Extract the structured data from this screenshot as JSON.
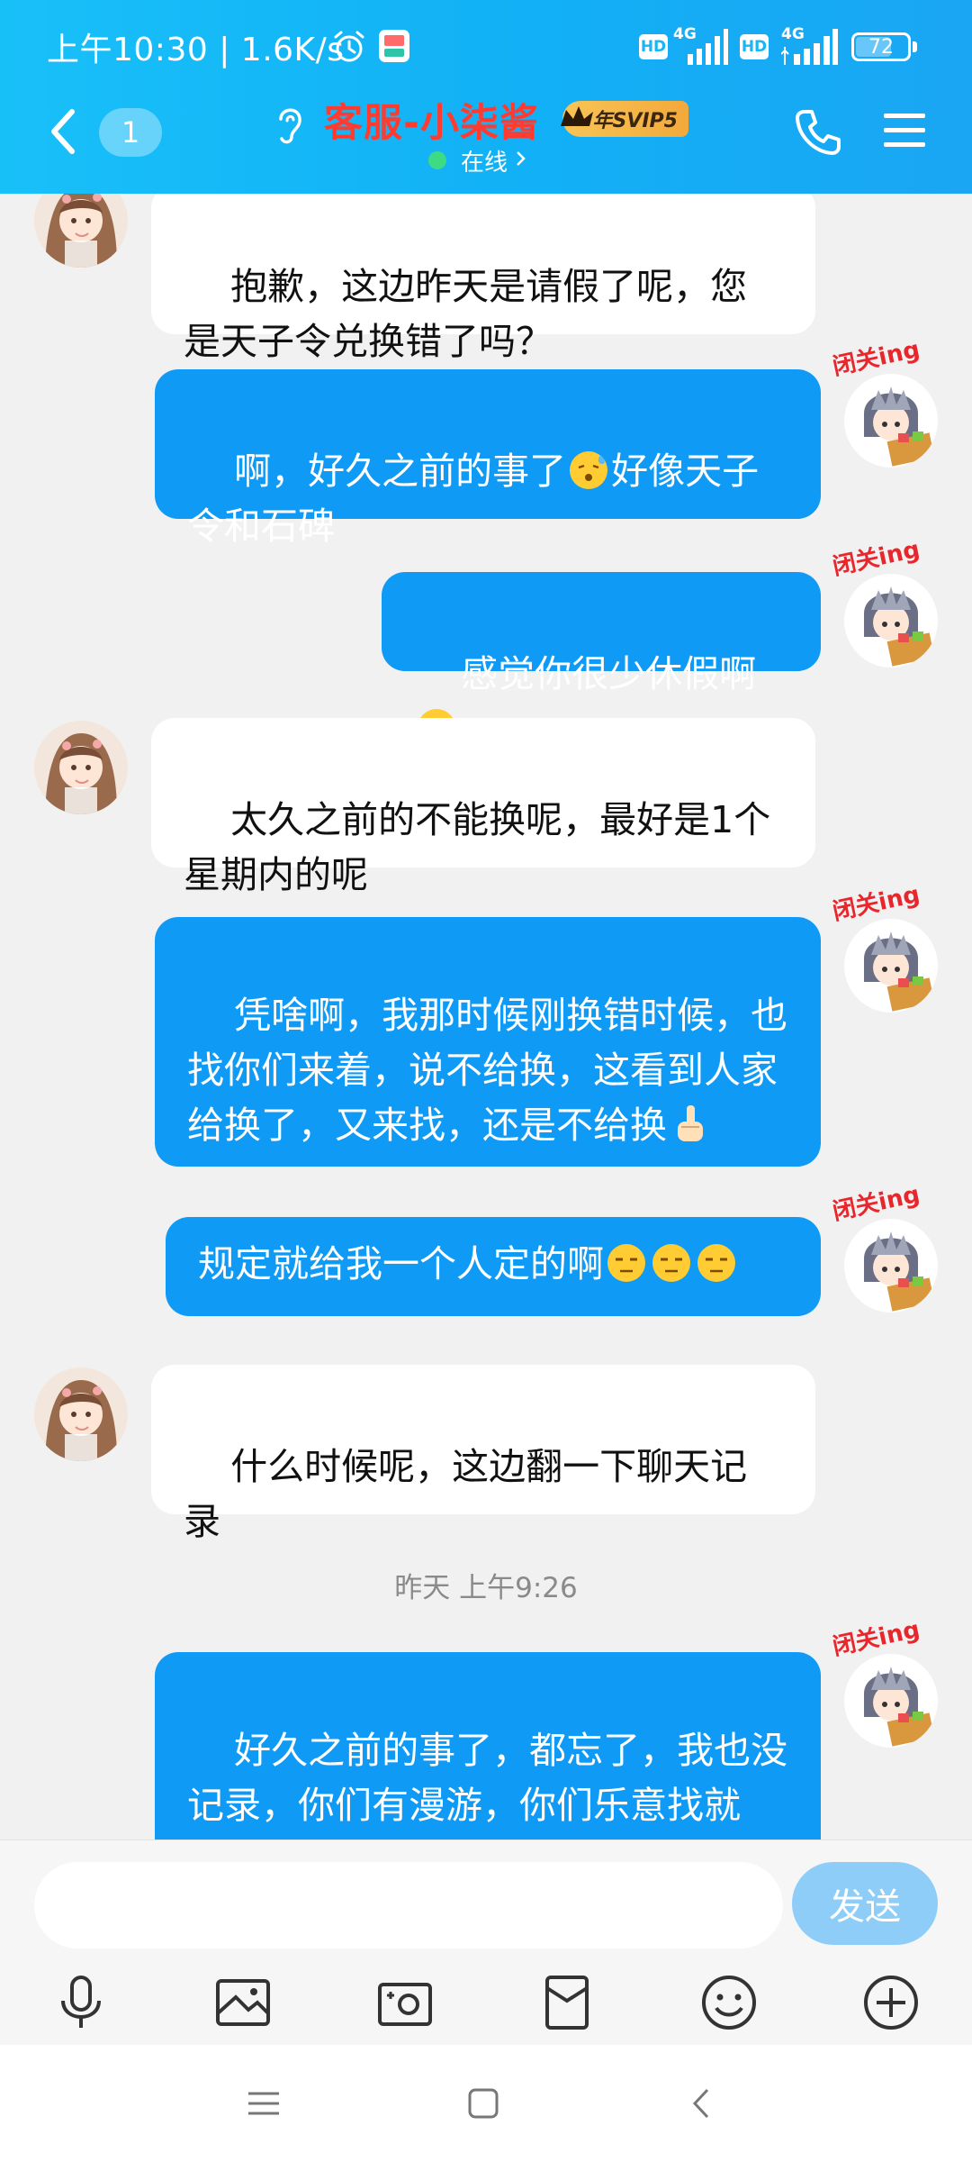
{
  "status_bar": {
    "time": "上午10:30",
    "separator": "|",
    "net_speed": "1.6K/s",
    "hd1": "HD",
    "net1": "4G",
    "hd2": "HD",
    "net2": "4G",
    "battery": "72",
    "battery_fraction": 0.72
  },
  "header": {
    "unread_count": "1",
    "contact_name": "客服-小柒酱",
    "vip_label": "年SVIP5",
    "online_status": "在线",
    "icons": [
      "back-arrow-icon",
      "ear-icon",
      "phone-icon",
      "menu-icon"
    ]
  },
  "messages": [
    {
      "side": "in",
      "text": "抱歉，这边昨天是请假了呢，您是天子令兑换错了吗？"
    },
    {
      "side": "out",
      "text_a": "啊，好久之前的事了",
      "text_b": "好像天子令和石碑",
      "emoji": "sweat-face-emoji"
    },
    {
      "side": "out",
      "text_a": "感觉你很少休假啊",
      "emoji": "thinking-face-emoji"
    },
    {
      "side": "in",
      "text": "太久之前的不能换呢，最好是1个星期内的呢"
    },
    {
      "side": "out",
      "text_a": "凭啥啊，我那时候刚换错时候，也找你们来着，说不给换，这看到人家给换了，又来找，还是不给换",
      "emoji": "pointing-hand-emoji"
    },
    {
      "side": "out",
      "text_a": "规定就给我一个人定的啊",
      "emoji": "speechless-face-emoji"
    },
    {
      "side": "in",
      "text": "什么时候呢，这边翻一下聊天记录"
    },
    {
      "side": "time",
      "text": "昨天 上午9:26"
    },
    {
      "side": "out",
      "text_a": "好久之前的事了，都忘了，我也没记录，你们有漫游，你们乐意找就找，不乐意找就算了！  很是无语"
    }
  ],
  "avatar_badge_text": "闭关ing",
  "input": {
    "placeholder": "",
    "send_label": "发送"
  },
  "toolbar_icons": [
    "microphone-icon",
    "image-icon",
    "camera-icon",
    "red-packet-icon",
    "emoji-icon",
    "plus-icon"
  ],
  "nav_icons": [
    "recent-apps-icon",
    "home-icon",
    "back-icon"
  ],
  "colors": {
    "header": "#15b8f7",
    "outgoing_bubble": "#0f9af5",
    "incoming_bubble": "#ffffff",
    "contact_name": "#ff3b30",
    "send_button": "#8ecdf7"
  }
}
